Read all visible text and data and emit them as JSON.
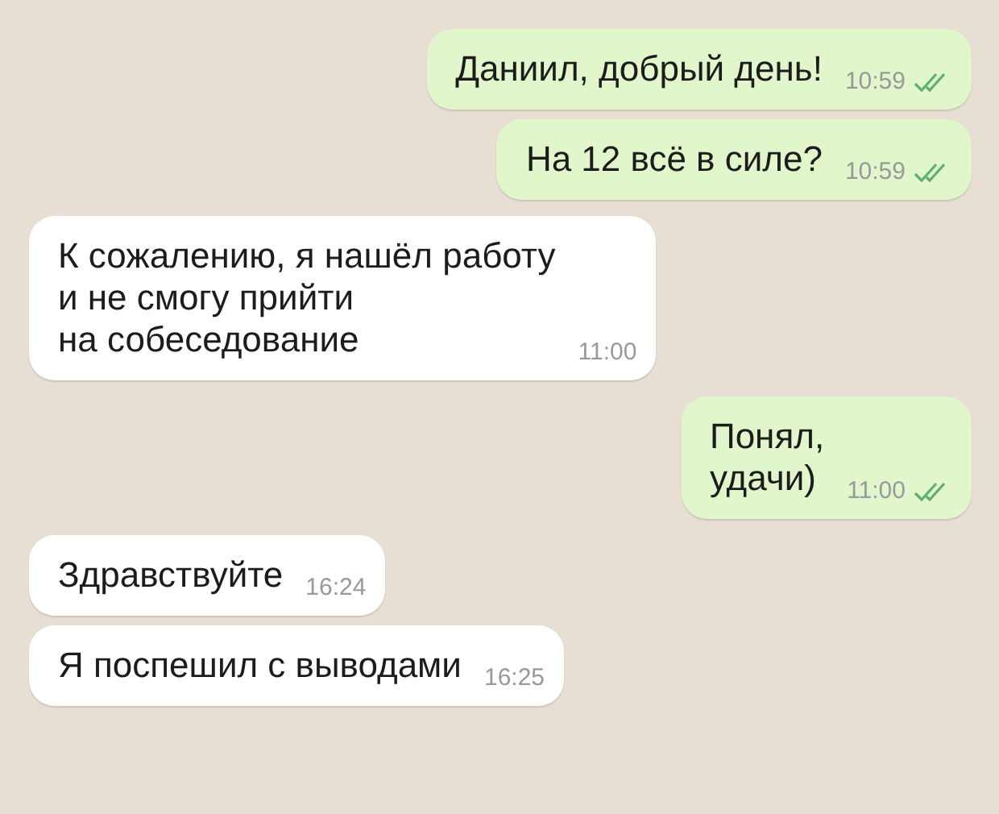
{
  "messages": [
    {
      "kind": "outgoing",
      "text": "Даниил, добрый день!",
      "time": "10:59",
      "read": true
    },
    {
      "kind": "outgoing",
      "text": "На 12 всё в силе?",
      "time": "10:59",
      "read": true
    },
    {
      "kind": "incoming",
      "text": "К сожалению, я нашёл работу\nи не смогу прийти\nна собеседование",
      "time": "11:00"
    },
    {
      "kind": "outgoing",
      "text": "Понял,\nудачи)",
      "time": "11:00",
      "read": true
    },
    {
      "kind": "incoming",
      "text": "Здравствуйте",
      "time": "16:24"
    },
    {
      "kind": "incoming",
      "text": "Я поспешил с выводами",
      "time": "16:25"
    }
  ]
}
